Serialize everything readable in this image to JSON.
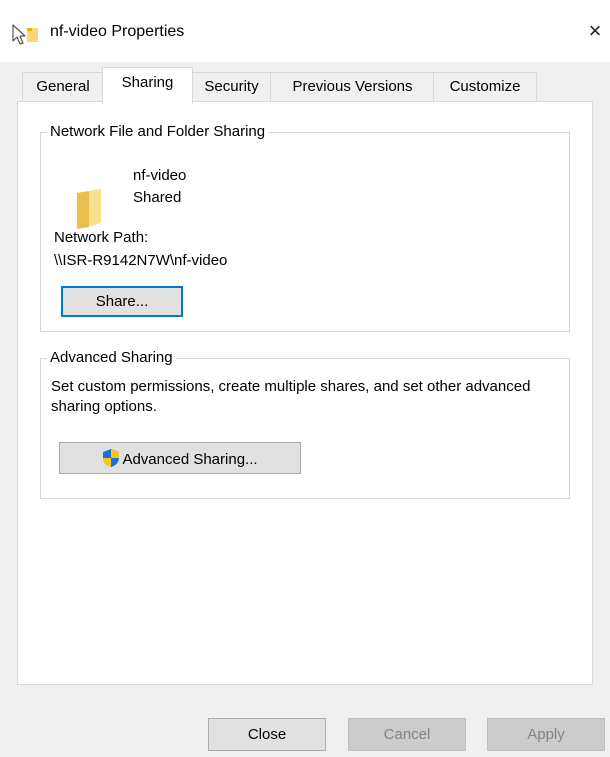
{
  "window": {
    "title": "nf-video Properties",
    "close_glyph": "×",
    "icon": "folder-shortcut-icon"
  },
  "tabs": [
    {
      "label": "General",
      "active": false
    },
    {
      "label": "Sharing",
      "active": true
    },
    {
      "label": "Security",
      "active": false
    },
    {
      "label": "Previous Versions",
      "active": false
    },
    {
      "label": "Customize",
      "active": false
    }
  ],
  "network_sharing": {
    "group_title": "Network File and Folder Sharing",
    "folder_icon": "folder-icon",
    "share_name": "nf-video",
    "share_status": "Shared",
    "network_path_label": "Network Path:",
    "network_path": "\\\\ISR-R9142N7W\\nf-video",
    "share_button": "Share..."
  },
  "advanced_sharing": {
    "group_title": "Advanced Sharing",
    "description": "Set custom permissions, create multiple shares, and set other advanced sharing options.",
    "button_icon": "uac-shield-icon",
    "button_label": "Advanced Sharing..."
  },
  "footer": {
    "close": "Close",
    "cancel": "Cancel",
    "apply": "Apply"
  },
  "colors": {
    "dialog_bg": "#f0f0f0",
    "panel_bg": "#ffffff",
    "focus_border": "#0078d7",
    "folder_yellow": "#f8d775"
  }
}
